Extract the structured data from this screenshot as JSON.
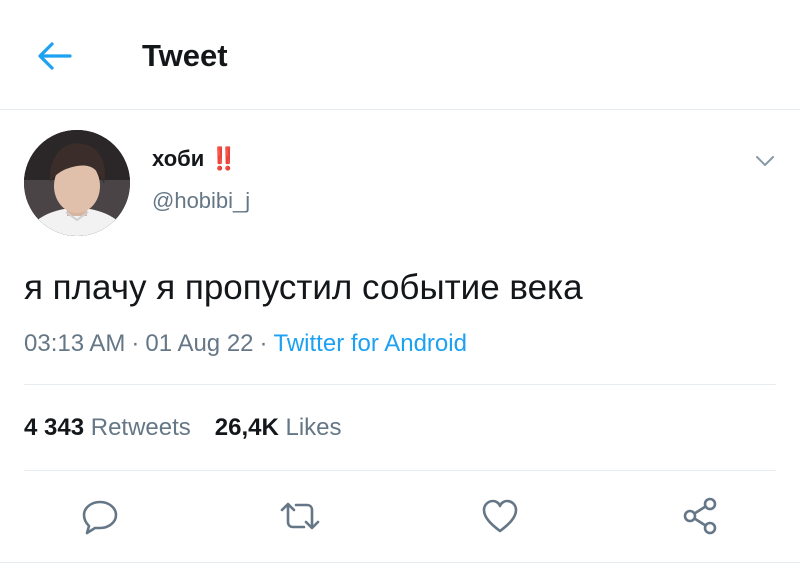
{
  "header": {
    "title": "Tweet",
    "back_icon": "arrow-left-icon",
    "accent_color": "#1da1f2"
  },
  "tweet": {
    "author": {
      "display_name": "хоби ‼️",
      "handle": "@hobibi_j"
    },
    "text": "я плачу я пропустил событие века",
    "time": "03:13 AM",
    "date": "01 Aug 22",
    "separator": "·",
    "source": "Twitter for Android",
    "stats": {
      "retweets_count": "4 343",
      "retweets_label": "Retweets",
      "likes_count": "26,4K",
      "likes_label": "Likes"
    }
  },
  "actions": {
    "reply_icon": "reply-icon",
    "retweet_icon": "retweet-icon",
    "like_icon": "heart-icon",
    "share_icon": "share-icon"
  },
  "colors": {
    "text_primary": "#14171a",
    "text_secondary": "#657786",
    "link": "#1da1f2",
    "divider": "#e6ecf0"
  }
}
